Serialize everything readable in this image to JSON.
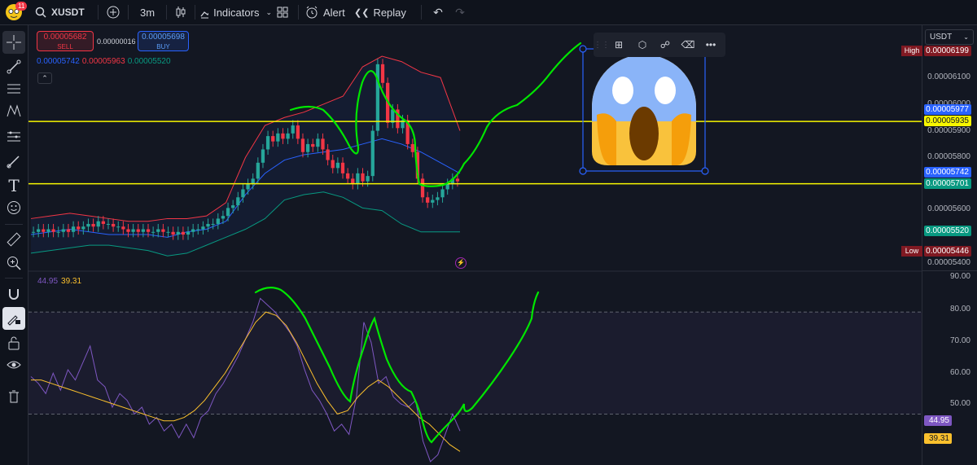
{
  "header": {
    "notif_count": "11",
    "symbol": "XUSDT",
    "interval": "3m",
    "indicators_label": "Indicators",
    "alert_label": "Alert",
    "replay_label": "Replay"
  },
  "trade": {
    "sell_price": "0.00005682",
    "sell_label": "SELL",
    "spread": "0.00000016",
    "buy_price": "0.00005698",
    "buy_label": "BUY"
  },
  "bb_legend": {
    "basis": "0.00005742",
    "upper": "0.00005963",
    "lower": "0.00005520"
  },
  "rsi_legend": {
    "rsi": "44.95",
    "ma": "39.31"
  },
  "price_scale": {
    "currency": "USDT",
    "high_label": "High",
    "high": "0.00006199",
    "low_label": "Low",
    "low": "0.00005446",
    "ticks": [
      "0.00006100",
      "0.00006000",
      "0.00005900",
      "0.00005800",
      "0.00005600",
      "0.00005400"
    ],
    "line_upper": "0.00005977",
    "line_upper2": "0.00005935",
    "basis": "0.00005742",
    "line_lower": "0.00005701",
    "lower_band": "0.00005520"
  },
  "rsi_scale": {
    "ticks": [
      "90.00",
      "80.00",
      "70.00",
      "60.00",
      "50.00"
    ],
    "rsi": "44.95",
    "ma": "39.31"
  },
  "colors": {
    "up": "#26a69a",
    "down": "#f23645",
    "bb_upper": "#f23645",
    "bb_basis": "#2962ff",
    "bb_lower": "#089981",
    "rsi": "#7e57c2",
    "rsi_ma": "#fbc02d",
    "drawing": "#00e600",
    "hline": "#f7f700"
  },
  "chart_data": {
    "type": "candlestick",
    "price_axis_range": [
      5.4e-05,
      6.22e-05
    ],
    "horizontal_lines": [
      5.935e-05,
      5.701e-05
    ],
    "close": [
      5.52e-05,
      5.53e-05,
      5.52e-05,
      5.53e-05,
      5.52e-05,
      5.52e-05,
      5.53e-05,
      5.52e-05,
      5.54e-05,
      5.53e-05,
      5.54e-05,
      5.55e-05,
      5.54e-05,
      5.56e-05,
      5.55e-05,
      5.55e-05,
      5.54e-05,
      5.54e-05,
      5.53e-05,
      5.52e-05,
      5.53e-05,
      5.52e-05,
      5.53e-05,
      5.52e-05,
      5.52e-05,
      5.53e-05,
      5.52e-05,
      5.52e-05,
      5.51e-05,
      5.52e-05,
      5.51e-05,
      5.52e-05,
      5.53e-05,
      5.53e-05,
      5.54e-05,
      5.55e-05,
      5.55e-05,
      5.57e-05,
      5.58e-05,
      5.61e-05,
      5.62e-05,
      5.65e-05,
      5.68e-05,
      5.7e-05,
      5.72e-05,
      5.78e-05,
      5.83e-05,
      5.88e-05,
      5.86e-05,
      5.89e-05,
      5.87e-05,
      5.89e-05,
      5.92e-05,
      5.87e-05,
      5.82e-05,
      5.85e-05,
      5.84e-05,
      5.87e-05,
      5.83e-05,
      5.79e-05,
      5.76e-05,
      5.78e-05,
      5.74e-05,
      5.72e-05,
      5.7e-05,
      5.74e-05,
      5.71e-05,
      5.73e-05,
      5.9e-05,
      6.15e-05,
      6.08e-05,
      5.93e-05,
      5.98e-05,
      5.91e-05,
      5.94e-05,
      5.85e-05,
      5.82e-05,
      5.72e-05,
      5.65e-05,
      5.63e-05,
      5.64e-05,
      5.65e-05,
      5.68e-05,
      5.7e-05,
      5.72e-05,
      5.71e-05
    ],
    "bb_upper": [
      5.57e-05,
      5.58e-05,
      5.59e-05,
      5.58e-05,
      5.57e-05,
      5.56e-05,
      5.56e-05,
      5.57e-05,
      5.57e-05,
      5.58e-05,
      5.63e-05,
      5.8e-05,
      5.92e-05,
      5.95e-05,
      5.97e-05,
      6e-05,
      6.03e-05,
      6.14e-05,
      6.18e-05,
      6.16e-05,
      6.12e-05,
      6.1e-05,
      5.9e-05
    ],
    "bb_basis": [
      5.51e-05,
      5.52e-05,
      5.53e-05,
      5.52e-05,
      5.51e-05,
      5.51e-05,
      5.51e-05,
      5.5e-05,
      5.52e-05,
      5.53e-05,
      5.56e-05,
      5.66e-05,
      5.74e-05,
      5.79e-05,
      5.81e-05,
      5.82e-05,
      5.83e-05,
      5.85e-05,
      5.87e-05,
      5.85e-05,
      5.82e-05,
      5.78e-05,
      5.74e-05
    ],
    "bb_lower": [
      5.44e-05,
      5.45e-05,
      5.46e-05,
      5.47e-05,
      5.47e-05,
      5.46e-05,
      5.45e-05,
      5.43e-05,
      5.44e-05,
      5.47e-05,
      5.5e-05,
      5.53e-05,
      5.57e-05,
      5.64e-05,
      5.66e-05,
      5.67e-05,
      5.65e-05,
      5.61e-05,
      5.6e-05,
      5.55e-05,
      5.52e-05,
      5.52e-05,
      5.52e-05
    ],
    "rsi_axis_range": [
      35,
      92
    ],
    "rsi_levels": [
      80,
      50
    ],
    "rsi": [
      61,
      59,
      56,
      62,
      57,
      63,
      60,
      65,
      70,
      60,
      58,
      52,
      56,
      54,
      50,
      52,
      47,
      49,
      45,
      47,
      43,
      47,
      43,
      49,
      51,
      56,
      59,
      63,
      67,
      72,
      77,
      84,
      82,
      80,
      77,
      74,
      70,
      63,
      57,
      54,
      50,
      45,
      47,
      44,
      55,
      77,
      71,
      59,
      61,
      55,
      53,
      52,
      54,
      42,
      36,
      38,
      44,
      50,
      45
    ],
    "rsi_ma": [
      60,
      60,
      59,
      58,
      57,
      56,
      55,
      54,
      53,
      52,
      51,
      50,
      49,
      48,
      48,
      49,
      51,
      54,
      58,
      62,
      67,
      72,
      77,
      80,
      79,
      76,
      71,
      65,
      59,
      54,
      50,
      51,
      55,
      58,
      60,
      58,
      55,
      52,
      49,
      47,
      44,
      41,
      39
    ]
  }
}
